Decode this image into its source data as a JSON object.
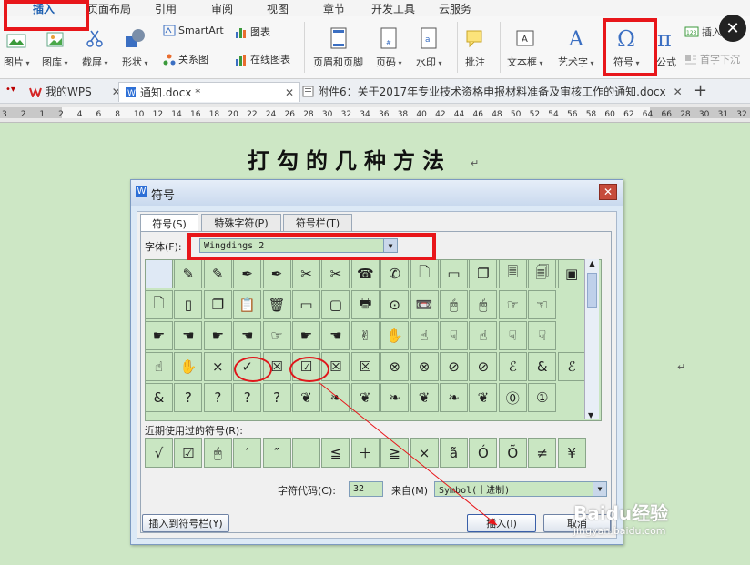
{
  "ribbon_tabs": [
    {
      "label": "插入",
      "active": true
    },
    {
      "label": "页面布局"
    },
    {
      "label": "引用"
    },
    {
      "label": "审阅"
    },
    {
      "label": "视图"
    },
    {
      "label": "章节"
    },
    {
      "label": "开发工具"
    },
    {
      "label": "云服务"
    }
  ],
  "ribbon": {
    "picture": "图片",
    "gallery": "图库",
    "screenshot": "截屏",
    "shapes": "形状",
    "smartart": "SmartArt",
    "relation": "关系图",
    "chart": "图表",
    "online_chart": "在线图表",
    "header_footer": "页眉和页脚",
    "page_number": "页码",
    "watermark": "水印",
    "comment": "批注",
    "textbox": "文本框",
    "wordart": "艺术字",
    "symbol": "符号",
    "formula": "公式",
    "insert_num": "插入",
    "dropcap": "首字下沉"
  },
  "doc_tabs": [
    {
      "label": "我的WPS"
    },
    {
      "label": "通知.docx *",
      "active": true
    },
    {
      "label": "附件6：关于2017年专业技术资格申报材料准备及审核工作的通知.docx"
    }
  ],
  "ruler_numbers": [
    "3",
    "2",
    "1",
    "2",
    "4",
    "6",
    "8",
    "10",
    "12",
    "14",
    "16",
    "18",
    "20",
    "22",
    "24",
    "26",
    "28",
    "30",
    "32",
    "34",
    "36",
    "38",
    "40",
    "42",
    "44",
    "46",
    "48",
    "50",
    "52",
    "54",
    "56",
    "58",
    "60",
    "62",
    "64",
    "66",
    "28",
    "30",
    "31",
    "32"
  ],
  "document": {
    "heading": "打勾的几种方法"
  },
  "dialog": {
    "title": "符号",
    "tabs": [
      "符号(S)",
      "特殊字符(P)",
      "符号栏(T)"
    ],
    "font_label": "字体(F):",
    "font_value": "Wingdings 2",
    "symbol_rows": [
      [
        "",
        " ✎",
        "✎",
        "✒",
        "✒",
        "✂",
        "✂",
        "☎",
        "✆",
        "🗋",
        "▭",
        "❐",
        "🗏",
        "🗐",
        "▣"
      ],
      [
        "🗋",
        "▯",
        "❐",
        "📋",
        "🗑",
        "▭",
        "▢",
        "🖶",
        "⊙",
        "📼",
        "🖱",
        "🖱",
        "☞",
        "☜"
      ],
      [
        "☛",
        "☚",
        "☛",
        "☚",
        "☞",
        "☛",
        "☚",
        "✌",
        "✋",
        "☝",
        "☟",
        "☝",
        "☟",
        "☟"
      ],
      [
        "☝",
        "✋",
        "×",
        "✓",
        "☒",
        "☑",
        "☒",
        "☒",
        "⊗",
        "⊗",
        "⊘",
        "⊘",
        "ℰ",
        "&",
        "ℰ"
      ],
      [
        "&",
        "?",
        "?",
        "?",
        "?",
        "❦",
        "❧",
        "❦",
        "❧",
        "❦",
        "❧",
        "❦",
        "⓪",
        "①"
      ]
    ],
    "recent_label": "近期使用过的符号(R):",
    "recent": [
      "√",
      "☑",
      "🖱",
      "′",
      "″",
      "",
      "≦",
      "＋",
      "≧",
      "×",
      "ã",
      "Ó",
      "Õ",
      "≠",
      "¥"
    ],
    "code_label": "字符代码(C):",
    "code_value": "32",
    "from_label": "来自(M)",
    "from_value": "Symbol(十进制)",
    "insert_to_bar": "插入到符号栏(Y)",
    "insert": "插入(I)",
    "cancel": "取消"
  },
  "watermark": {
    "brand": "Baidu经验",
    "url": "jingyan.baidu.com"
  },
  "colors": {
    "highlight": "#e8161a",
    "page_bg": "#cde7c5",
    "cell_bg": "#c9e6c2"
  }
}
